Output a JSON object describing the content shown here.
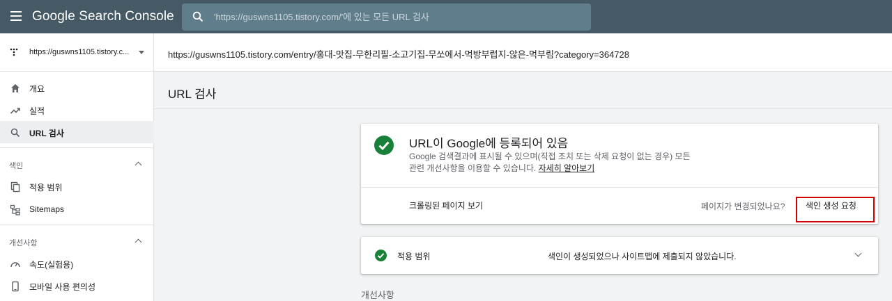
{
  "app": {
    "title": "Google Search Console"
  },
  "search": {
    "placeholder": "'https://guswns1105.tistory.com/'에 있는 모든 URL 검사"
  },
  "property": {
    "label": "https://guswns1105.tistory.c..."
  },
  "sidebar": {
    "top_items": [
      {
        "label": "개요",
        "icon": "home-icon"
      },
      {
        "label": "실적",
        "icon": "trending-up-icon"
      },
      {
        "label": "URL 검사",
        "icon": "search-icon",
        "active": true
      }
    ],
    "index_section": {
      "title": "색인",
      "items": [
        {
          "label": "적용 범위",
          "icon": "file-copy-icon"
        },
        {
          "label": "Sitemaps",
          "icon": "sitemap-icon"
        }
      ]
    },
    "enh_section": {
      "title": "개선사항",
      "items": [
        {
          "label": "속도(실험용)",
          "icon": "speedometer-icon"
        },
        {
          "label": "모바일 사용 편의성",
          "icon": "smartphone-icon"
        }
      ]
    }
  },
  "inspected_url": "https://guswns1105.tistory.com/entry/홍대-맛집-무한리필-소고기집-무쏘에서-먹방부럽지-않은-먹부림?category=364728",
  "page": {
    "title": "URL 검사"
  },
  "status_card": {
    "title": "URL이 Google에 등록되어 있음",
    "desc_line1": "Google 검색결과에 표시될 수 있으며(직접 조치 또는 삭제 요청이 없는 경우) 모든",
    "desc_line2": "관련 개선사항을 이용할 수 있습니다.",
    "learn_more": "자세히 알아보기",
    "crawled_page": "크롤링된 페이지 보기",
    "page_changed": "페이지가 변경되었나요?",
    "request_indexing": "색인 생성 요청"
  },
  "coverage": {
    "label": "적용 범위",
    "status": "색인이 생성되었으나 사이트맵에 제출되지 않았습니다."
  },
  "enhancements_heading": "개선사항",
  "colors": {
    "topbar": "#455a64",
    "search_bg": "#607d8b",
    "success": "#188038",
    "highlight": "#d50000"
  }
}
